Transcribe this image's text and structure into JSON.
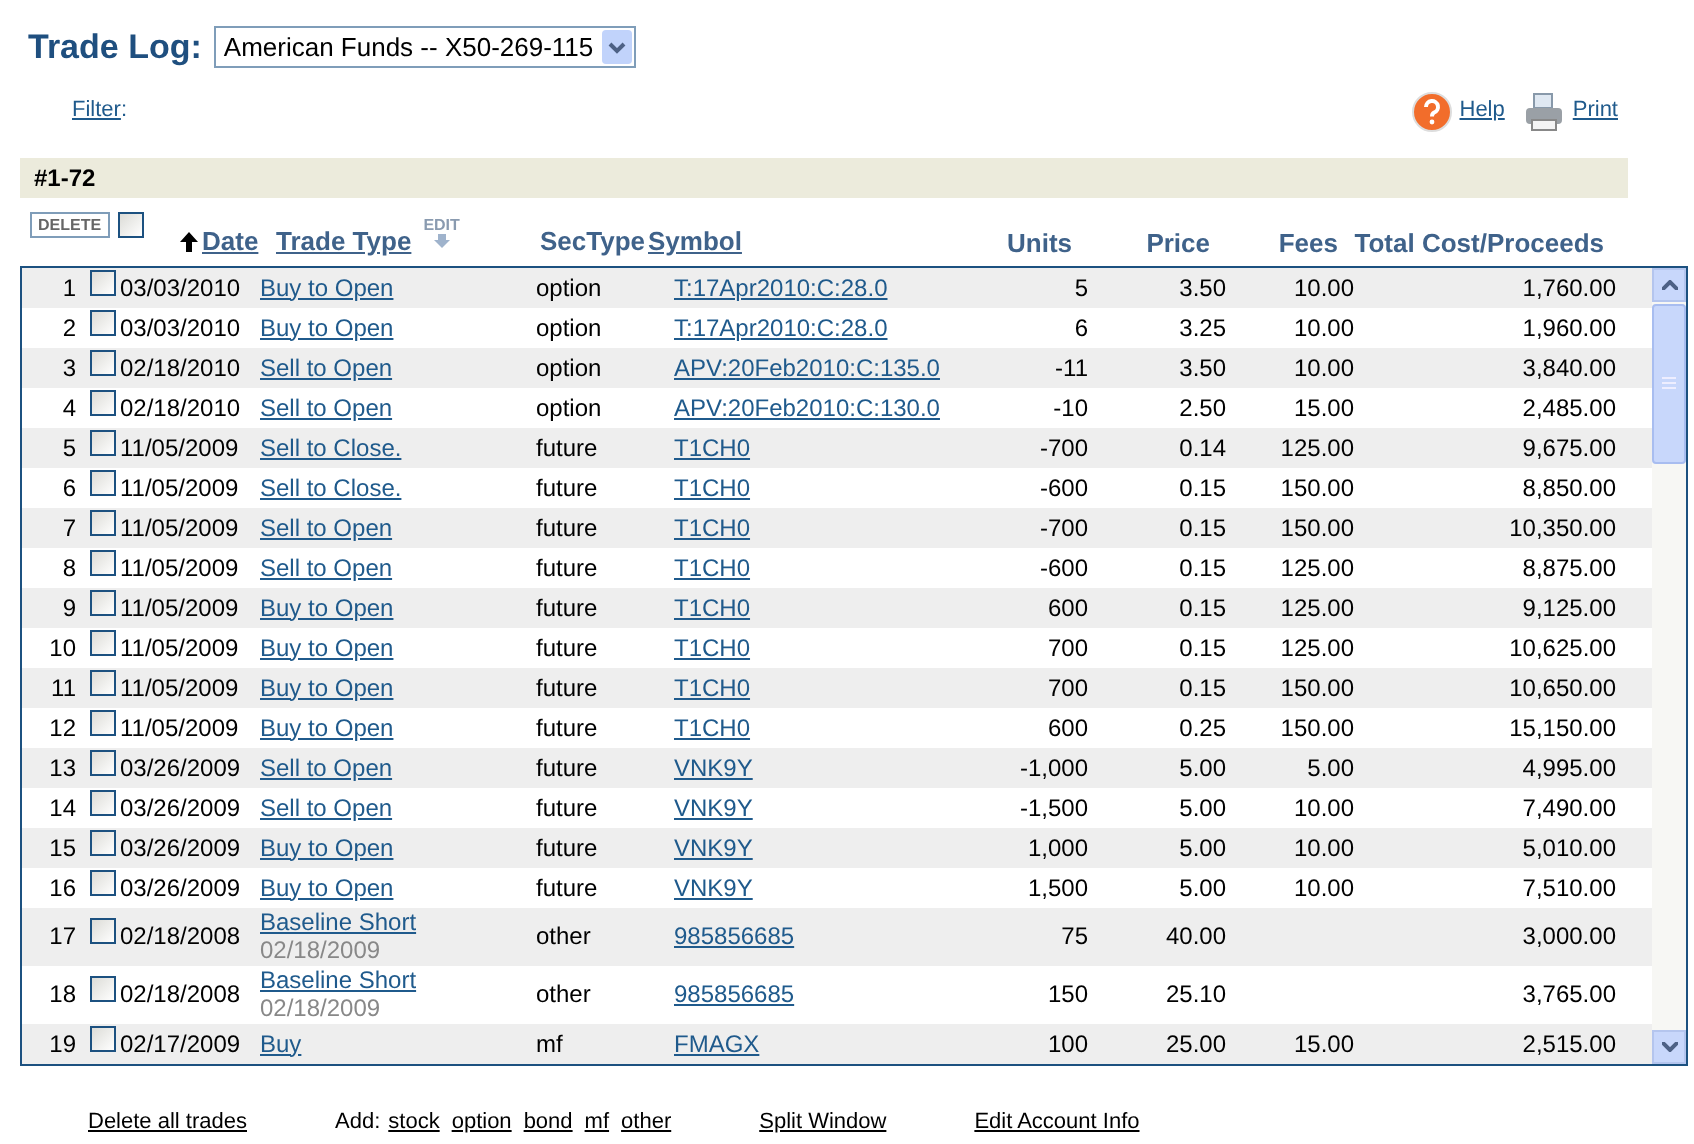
{
  "title": "Trade Log:",
  "account_select": {
    "value": "American Funds -- X50-269-115"
  },
  "filter_link": "Filter",
  "filter_colon": ":",
  "help_link": "Help",
  "print_link": "Print",
  "range_label": "#1-72",
  "delete_button": "DELETE",
  "select_all": {
    "checked": false
  },
  "columns": [
    {
      "kind": "sort",
      "label": "Date"
    },
    {
      "kind": "edit",
      "label": "Trade Type",
      "edit_label": "EDIT"
    },
    {
      "kind": "plain",
      "label": "SecType"
    },
    {
      "kind": "link",
      "label": "Symbol"
    },
    {
      "kind": "num",
      "label": "Units"
    },
    {
      "kind": "num",
      "label": "Price"
    },
    {
      "kind": "num",
      "label": "Fees"
    },
    {
      "kind": "num",
      "label": "Total Cost/Proceeds"
    }
  ],
  "rows": [
    {
      "num": "1",
      "checked": false,
      "date": "03/03/2010",
      "trade_type": "Buy to Open",
      "sectype": "option",
      "symbol": "T:17Apr2010:C:28.0",
      "units": "5",
      "price": "3.50",
      "fees": "10.00",
      "total": "1,760.00"
    },
    {
      "num": "2",
      "checked": false,
      "date": "03/03/2010",
      "trade_type": "Buy to Open",
      "sectype": "option",
      "symbol": "T:17Apr2010:C:28.0",
      "units": "6",
      "price": "3.25",
      "fees": "10.00",
      "total": "1,960.00"
    },
    {
      "num": "3",
      "checked": false,
      "date": "02/18/2010",
      "trade_type": "Sell to Open",
      "sectype": "option",
      "symbol": "APV:20Feb2010:C:135.0",
      "units": "-11",
      "price": "3.50",
      "fees": "10.00",
      "total": "3,840.00"
    },
    {
      "num": "4",
      "checked": false,
      "date": "02/18/2010",
      "trade_type": "Sell to Open",
      "sectype": "option",
      "symbol": "APV:20Feb2010:C:130.0",
      "units": "-10",
      "price": "2.50",
      "fees": "15.00",
      "total": "2,485.00"
    },
    {
      "num": "5",
      "checked": false,
      "date": "11/05/2009",
      "trade_type": "Sell to Close.",
      "sectype": "future",
      "symbol": "T1CH0",
      "units": "-700",
      "price": "0.14",
      "fees": "125.00",
      "total": "9,675.00"
    },
    {
      "num": "6",
      "checked": false,
      "date": "11/05/2009",
      "trade_type": "Sell to Close.",
      "sectype": "future",
      "symbol": "T1CH0",
      "units": "-600",
      "price": "0.15",
      "fees": "150.00",
      "total": "8,850.00"
    },
    {
      "num": "7",
      "checked": false,
      "date": "11/05/2009",
      "trade_type": "Sell to Open",
      "sectype": "future",
      "symbol": "T1CH0",
      "units": "-700",
      "price": "0.15",
      "fees": "150.00",
      "total": "10,350.00"
    },
    {
      "num": "8",
      "checked": false,
      "date": "11/05/2009",
      "trade_type": "Sell to Open",
      "sectype": "future",
      "symbol": "T1CH0",
      "units": "-600",
      "price": "0.15",
      "fees": "125.00",
      "total": "8,875.00"
    },
    {
      "num": "9",
      "checked": false,
      "date": "11/05/2009",
      "trade_type": "Buy to Open",
      "sectype": "future",
      "symbol": "T1CH0",
      "units": "600",
      "price": "0.15",
      "fees": "125.00",
      "total": "9,125.00"
    },
    {
      "num": "10",
      "checked": false,
      "date": "11/05/2009",
      "trade_type": "Buy to Open",
      "sectype": "future",
      "symbol": "T1CH0",
      "units": "700",
      "price": "0.15",
      "fees": "125.00",
      "total": "10,625.00"
    },
    {
      "num": "11",
      "checked": false,
      "date": "11/05/2009",
      "trade_type": "Buy to Open",
      "sectype": "future",
      "symbol": "T1CH0",
      "units": "700",
      "price": "0.15",
      "fees": "150.00",
      "total": "10,650.00"
    },
    {
      "num": "12",
      "checked": false,
      "date": "11/05/2009",
      "trade_type": "Buy to Open",
      "sectype": "future",
      "symbol": "T1CH0",
      "units": "600",
      "price": "0.25",
      "fees": "150.00",
      "total": "15,150.00"
    },
    {
      "num": "13",
      "checked": false,
      "date": "03/26/2009",
      "trade_type": "Sell to Open",
      "sectype": "future",
      "symbol": "VNK9Y",
      "units": "-1,000",
      "price": "5.00",
      "fees": "5.00",
      "total": "4,995.00"
    },
    {
      "num": "14",
      "checked": false,
      "date": "03/26/2009",
      "trade_type": "Sell to Open",
      "sectype": "future",
      "symbol": "VNK9Y",
      "units": "-1,500",
      "price": "5.00",
      "fees": "10.00",
      "total": "7,490.00"
    },
    {
      "num": "15",
      "checked": false,
      "date": "03/26/2009",
      "trade_type": "Buy to Open",
      "sectype": "future",
      "symbol": "VNK9Y",
      "units": "1,000",
      "price": "5.00",
      "fees": "10.00",
      "total": "5,010.00"
    },
    {
      "num": "16",
      "checked": false,
      "date": "03/26/2009",
      "trade_type": "Buy to Open",
      "sectype": "future",
      "symbol": "VNK9Y",
      "units": "1,500",
      "price": "5.00",
      "fees": "10.00",
      "total": "7,510.00"
    },
    {
      "num": "17",
      "checked": false,
      "date": "02/18/2008",
      "trade_type": "Baseline Short",
      "sub_date": "02/18/2009",
      "sectype": "other",
      "symbol": "985856685",
      "units": "75",
      "price": "40.00",
      "total": "3,000.00"
    },
    {
      "num": "18",
      "checked": false,
      "date": "02/18/2008",
      "trade_type": "Baseline Short",
      "sub_date": "02/18/2009",
      "sectype": "other",
      "symbol": "985856685",
      "units": "150",
      "price": "25.10",
      "total": "3,765.00"
    },
    {
      "num": "19",
      "checked": false,
      "date": "02/17/2009",
      "trade_type": "Buy",
      "sectype": "mf",
      "symbol": "FMAGX",
      "units": "100",
      "price": "25.00",
      "fees": "15.00",
      "total": "2,515.00"
    }
  ],
  "footer": {
    "delete_all": "Delete all trades",
    "add_label": "Add:",
    "add_links": [
      "stock",
      "option",
      "bond",
      "mf",
      "other"
    ],
    "split_window": "Split Window",
    "edit_account": "Edit Account Info"
  }
}
